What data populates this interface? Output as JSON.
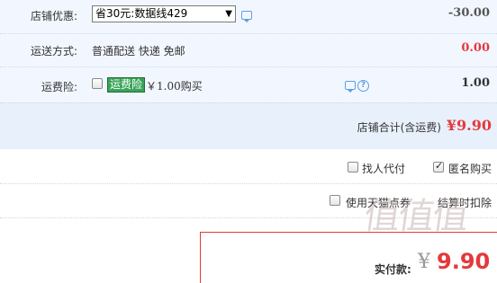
{
  "store": {
    "discount": {
      "label": "店铺优惠:",
      "selected": "省30元:数据线429",
      "arrow": "▼",
      "amount": "-30.00"
    },
    "shipping": {
      "label": "运送方式:",
      "text": "普通配送 快递 免邮",
      "amount": "0.00"
    },
    "insurance": {
      "label": "运费险:",
      "badge": "运费险",
      "price": "￥1.00购买",
      "help": "?",
      "amount": "1.00",
      "checked": false
    },
    "subtotal": {
      "label": "店铺合计(含运费)",
      "value": "¥9.90"
    }
  },
  "options": {
    "proxy_label": "找人代付",
    "proxy_checked": false,
    "anonymous_label": "匿名购买",
    "anonymous_checked": true,
    "points_label": "使用天猫点券",
    "points_checked": false,
    "points_note": "结算时扣除"
  },
  "payment": {
    "label": "实付款:",
    "currency": "¥",
    "value": "9.90"
  },
  "colors": {
    "accent_red": "#e4393c",
    "badge_green": "#3aa35a",
    "icon_blue": "#5aa0e6"
  }
}
